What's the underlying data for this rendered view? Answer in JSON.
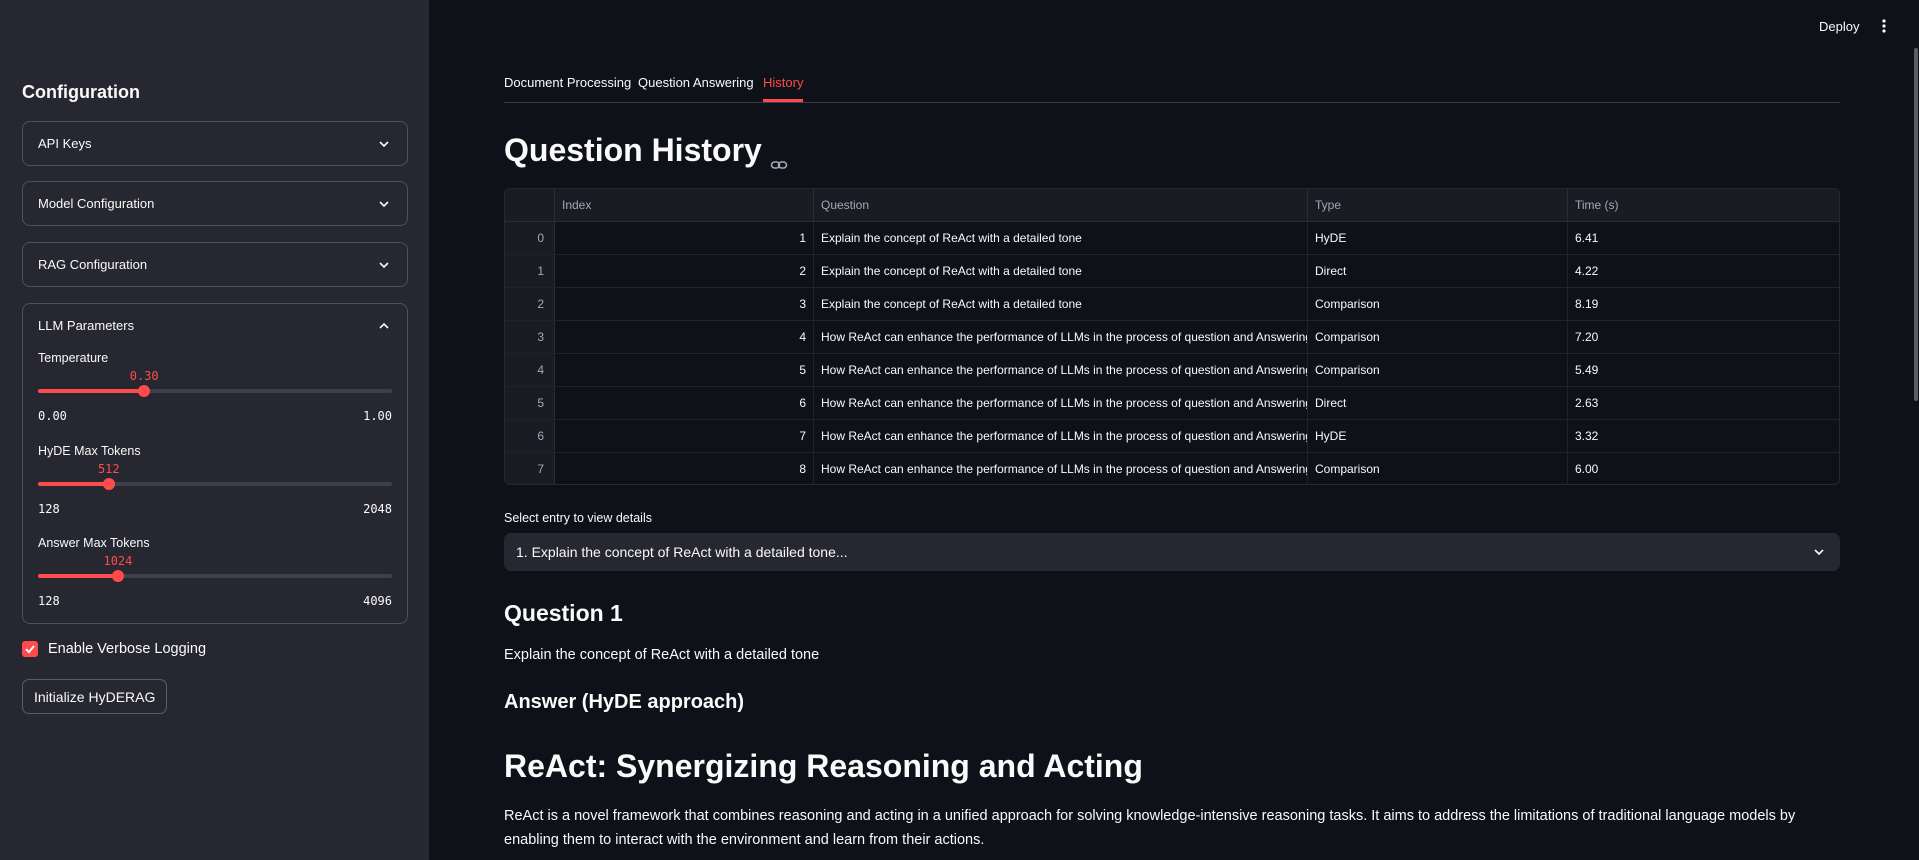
{
  "header": {
    "deploy_label": "Deploy"
  },
  "sidebar": {
    "title": "Configuration",
    "expanders": [
      {
        "label": "API Keys"
      },
      {
        "label": "Model Configuration"
      },
      {
        "label": "RAG Configuration"
      },
      {
        "label": "LLM Parameters"
      }
    ],
    "sliders": [
      {
        "label": "Temperature",
        "value": "0.30",
        "min": "0.00",
        "max": "1.00",
        "fraction": 0.3
      },
      {
        "label": "HyDE Max Tokens",
        "value": "512",
        "min": "128",
        "max": "2048",
        "fraction": 0.2
      },
      {
        "label": "Answer Max Tokens",
        "value": "1024",
        "min": "128",
        "max": "4096",
        "fraction": 0.2258
      }
    ],
    "checkbox": {
      "label": "Enable Verbose Logging",
      "checked": true
    },
    "button": {
      "label": "Initialize HyDERAG"
    }
  },
  "tabs": [
    {
      "label": "Document Processing"
    },
    {
      "label": "Question Answering"
    },
    {
      "label": "History"
    }
  ],
  "main": {
    "title": "Question History",
    "table": {
      "columns": [
        "Index",
        "Question",
        "Type",
        "Time (s)"
      ],
      "rows": [
        {
          "row": "0",
          "index": "1",
          "question": "Explain the concept of ReAct with a detailed tone",
          "type": "HyDE",
          "time": "6.41"
        },
        {
          "row": "1",
          "index": "2",
          "question": "Explain the concept of ReAct with a detailed tone",
          "type": "Direct",
          "time": "4.22"
        },
        {
          "row": "2",
          "index": "3",
          "question": "Explain the concept of ReAct with a detailed tone",
          "type": "Comparison",
          "time": "8.19"
        },
        {
          "row": "3",
          "index": "4",
          "question": "How ReAct can enhance the performance of LLMs in the process of question and Answering",
          "type": "Comparison",
          "time": "7.20"
        },
        {
          "row": "4",
          "index": "5",
          "question": "How ReAct can enhance the performance of LLMs in the process of question and Answering",
          "type": "Comparison",
          "time": "5.49"
        },
        {
          "row": "5",
          "index": "6",
          "question": "How ReAct can enhance the performance of LLMs in the process of question and Answering",
          "type": "Direct",
          "time": "2.63"
        },
        {
          "row": "6",
          "index": "7",
          "question": "How ReAct can enhance the performance of LLMs in the process of question and Answering",
          "type": "HyDE",
          "time": "3.32"
        },
        {
          "row": "7",
          "index": "8",
          "question": "How ReAct can enhance the performance of LLMs in the process of question and Answering",
          "type": "Comparison",
          "time": "6.00"
        }
      ]
    },
    "select_label": "Select entry to view details",
    "select_value": "1. Explain the concept of ReAct with a detailed tone...",
    "question_heading": "Question 1",
    "question_text": "Explain the concept of ReAct with a detailed tone",
    "answer_heading": "Answer (HyDE approach)",
    "answer_title": "ReAct: Synergizing Reasoning and Acting",
    "answer_paragraph": "ReAct is a novel framework that combines reasoning and acting in a unified approach for solving knowledge-intensive reasoning tasks. It aims to address the limitations of traditional language models by enabling them to interact with the environment and learn from their actions."
  },
  "colors": {
    "accent": "#ff4b4b",
    "sidebar_bg": "#262730",
    "main_bg": "#0e1117"
  }
}
